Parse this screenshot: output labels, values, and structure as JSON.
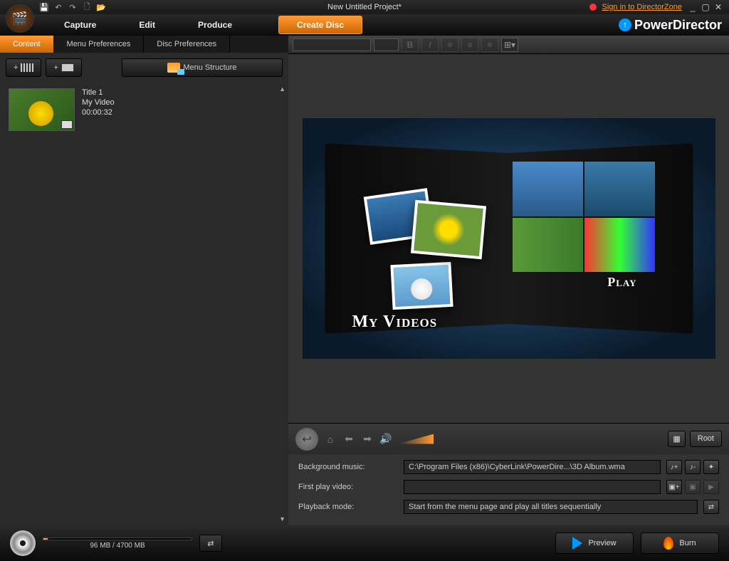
{
  "titlebar": {
    "title": "New Untitled Project*",
    "directorzone": "Sign in to DirectorZone"
  },
  "header": {
    "tabs": {
      "capture": "Capture",
      "edit": "Edit",
      "produce": "Produce"
    },
    "create_disc": "Create Disc",
    "brand": "PowerDirector"
  },
  "subtabs": {
    "content": "Content",
    "menu_prefs": "Menu Preferences",
    "disc_prefs": "Disc Preferences"
  },
  "menu_structure": "Menu Structure",
  "item": {
    "title": "Title 1",
    "name": "My Video",
    "duration": "00:00:32"
  },
  "preview": {
    "my_videos": "My Videos",
    "play": "Play"
  },
  "nav": {
    "root": "Root"
  },
  "settings": {
    "bgmusic_label": "Background music:",
    "bgmusic_value": "C:\\Program Files (x86)\\CyberLink\\PowerDire...\\3D Album.wma",
    "firstplay_label": "First play video:",
    "firstplay_value": "",
    "playback_label": "Playback mode:",
    "playback_value": "Start from the menu page and play all titles sequentially"
  },
  "bottom": {
    "capacity": "96 MB / 4700 MB",
    "preview": "Preview",
    "burn": "Burn"
  }
}
